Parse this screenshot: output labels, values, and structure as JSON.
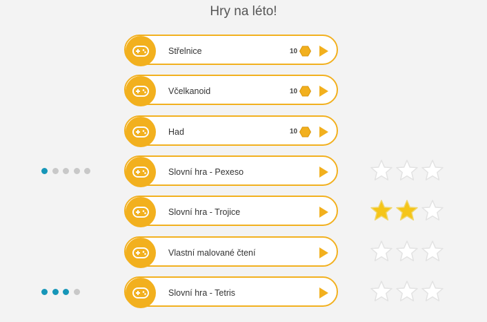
{
  "page": {
    "title": "Hry na léto!"
  },
  "colors": {
    "accent": "#f2b01e",
    "progress_on": "#1696b8",
    "progress_off": "#c8c8c8",
    "star_on": "#f5c518"
  },
  "games": [
    {
      "label": "Střelnice",
      "icon": "gamepad-icon",
      "cost": "10",
      "progress": null,
      "stars": null
    },
    {
      "label": "Včelkanoid",
      "icon": "gamepad-icon",
      "cost": "10",
      "progress": null,
      "stars": null
    },
    {
      "label": "Had",
      "icon": "gamepad-icon",
      "cost": "10",
      "progress": null,
      "stars": null
    },
    {
      "label": "Slovní hra - Pexeso",
      "icon": "gamepad-icon",
      "cost": null,
      "progress": {
        "done": 1,
        "total": 5
      },
      "stars": {
        "filled": 0,
        "total": 3
      }
    },
    {
      "label": "Slovní hra - Trojice",
      "icon": "gamepad-icon",
      "cost": null,
      "progress": null,
      "stars": {
        "filled": 2,
        "total": 3
      }
    },
    {
      "label": "Vlastní malované čtení",
      "icon": "gamepad-icon",
      "cost": null,
      "progress": null,
      "stars": {
        "filled": 0,
        "total": 3
      }
    },
    {
      "label": "Slovní hra - Tetris",
      "icon": "gamepad-icon",
      "cost": null,
      "progress": {
        "done": 3,
        "total": 4
      },
      "stars": {
        "filled": 0,
        "total": 3
      }
    }
  ]
}
